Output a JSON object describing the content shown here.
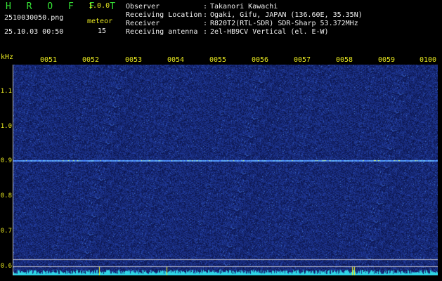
{
  "header": {
    "app_name": "H R O F F T",
    "version": "1.0.0",
    "filename": "2510030050.png",
    "meteor_label": "meteor",
    "datetime": "25.10.03 00:50",
    "meteor_count": "15",
    "info": [
      {
        "label": "Observer",
        "value": "Takanori Kawachi"
      },
      {
        "label": "Receiving Location",
        "value": "Ogaki, Gifu, JAPAN (136.60E, 35.35N)"
      },
      {
        "label": "Receiver",
        "value": "R820T2(RTL-SDR) SDR-Sharp 53.372MHz"
      },
      {
        "label": "Receiving antenna",
        "value": "2el-HB9CV Vertical (el. E-W)"
      }
    ],
    "colon": ":"
  },
  "plot": {
    "y_unit": "kHz",
    "y_ticks": [
      "1.1",
      "1.0",
      "0.9",
      "0.8",
      "0.7",
      "0.6"
    ],
    "x_ticks": [
      "0051",
      "0052",
      "0053",
      "0054",
      "0055",
      "0056",
      "0057",
      "0058",
      "0059",
      "0100"
    ],
    "colors": {
      "axis_text": "#e8e820",
      "background_noise": "#1c2e86",
      "carrier": "#6fc8ff",
      "spectrum": "#2fd6e6"
    }
  }
}
